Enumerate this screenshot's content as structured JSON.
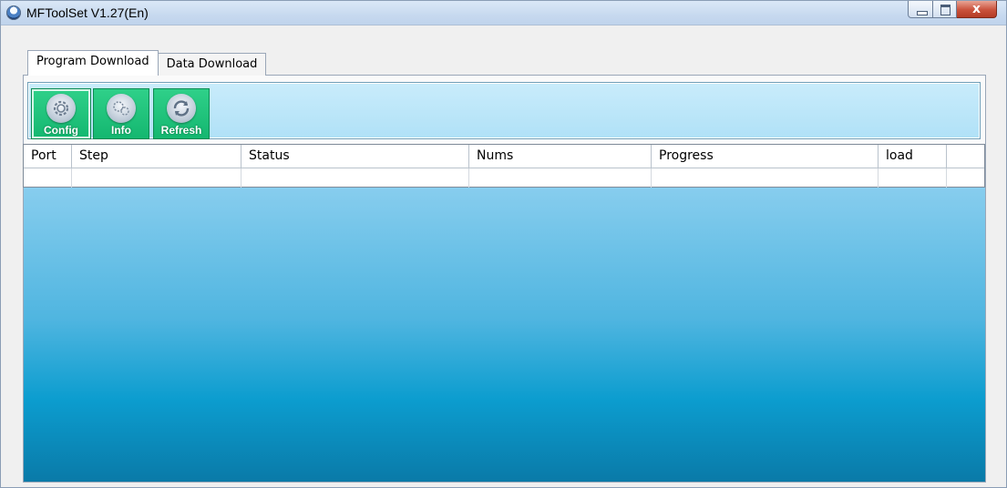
{
  "window": {
    "title": "MFToolSet V1.27(En)",
    "close_glyph": "x"
  },
  "tabs": [
    {
      "label": "Program Download",
      "active": true
    },
    {
      "label": "Data Download",
      "active": false
    }
  ],
  "toolbar": {
    "buttons": [
      {
        "label": "Config",
        "icon": "gear-icon"
      },
      {
        "label": "Info",
        "icon": "gears-info-icon"
      },
      {
        "label": "Refresh",
        "icon": "refresh-icon"
      }
    ]
  },
  "grid": {
    "columns": [
      "Port",
      "Step",
      "Status",
      "Nums",
      "Progress",
      "load",
      ""
    ],
    "rows": [
      [
        "",
        "",
        "",
        "",
        "",
        "",
        ""
      ]
    ]
  },
  "colors": {
    "button_green": "#14b770",
    "toolbar_bg": "#b0e1f7",
    "panel_gradient_top": "#87cdee",
    "panel_gradient_bottom": "#0a7aa8"
  }
}
